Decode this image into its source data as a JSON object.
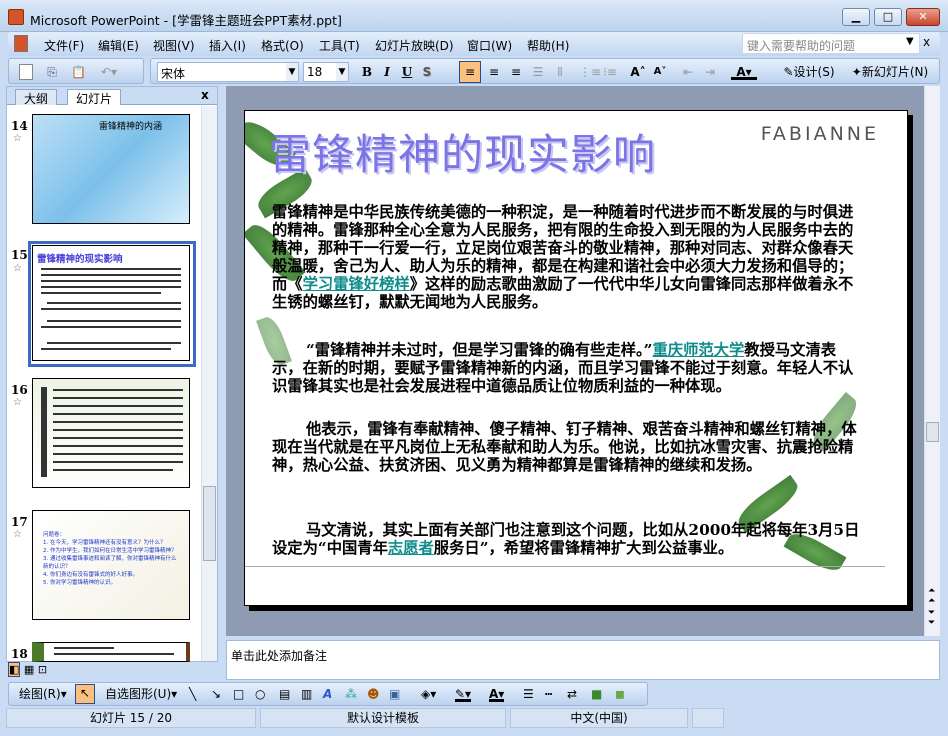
{
  "window": {
    "title": "Microsoft PowerPoint - [学雷锋主题班会PPT素材.ppt]",
    "controls": [
      "minimize",
      "restore",
      "close"
    ]
  },
  "menu": [
    "文件(F)",
    "编辑(E)",
    "视图(V)",
    "插入(I)",
    "格式(O)",
    "工具(T)",
    "幻灯片放映(D)",
    "窗口(W)",
    "帮助(H)"
  ],
  "help_placeholder": "键入需要帮助的问题",
  "toolbar": {
    "font": "宋体",
    "size": "18",
    "bold": "B",
    "italic": "I",
    "underline": "U",
    "shadow": "S",
    "design": "设计(S)",
    "new_slide": "新幻灯片(N)"
  },
  "pane": {
    "tabs": [
      "大纲",
      "幻灯片"
    ],
    "close": "x",
    "thumbs": [
      {
        "num": "14",
        "title": "雷锋精神的内涵"
      },
      {
        "num": "15",
        "title": "雷锋精神的现实影响",
        "selected": true
      },
      {
        "num": "16"
      },
      {
        "num": "17",
        "lines": [
          "问题卷：",
          "1. 在今天，学习雷锋精神还有没有意义？为什么？",
          "2. 作为中学生，我们如何在日常生活中学习雷锋精神？",
          "3. 通过收集雷锋事迹和阅读了解，你对雷锋精神有什么新的认识？",
          "4. 你们身边有没有雷锋式的好人好事。",
          "5. 你对学习雷锋精神的认识。"
        ]
      },
      {
        "num": "18"
      }
    ]
  },
  "slide": {
    "title": "雷锋精神的现实影响",
    "brand": "FABIANNE",
    "p1": [
      "雷锋精神是中华民族传统美德的一种积淀，是一种随着时代进步而不断发展的与时俱进的精神。雷锋那种全心全意为人民服务，把有限的生命投入到无限的为人民服务中去的精神，那种干一行爱一行，立足岗位艰苦奋斗的敬业精神，那种对同志、对群众像春天般温暖，舍己为人、助人为乐的精神，都是在构建和谐社会中必须大力发扬和倡导的；而《",
      "学习雷锋好榜样",
      "》这样的励志歌曲激励了一代代中华儿女向雷锋同志那样做着永不生锈的螺丝钉，默默无闻地为人民服务。"
    ],
    "p2": [
      "“雷锋精神并未过时，但是学习雷锋的确有些走样。”",
      "重庆师范大学",
      "教授马文清表示，在新的时期，要赋予雷锋精神新的内涵，而且学习雷锋不能过于刻意。年轻人不认识雷锋其实也是社会发展进程中道德品质让位物质利益的一种体现。"
    ],
    "p3": "他表示，雷锋有奉献精神、傻子精神、钉子精神、艰苦奋斗精神和螺丝钉精神，体现在当代就是在平凡岗位上无私奉献和助人为乐。他说，比如抗冰雪灾害、抗震抢险精神，热心公益、扶贫济困、见义勇为精神都算是雷锋精神的继续和发扬。",
    "p4": [
      "马文清说，其实上面有关部门也注意到这个问题，比如从2000年起将每年3月5日设定为“中国青年",
      "志愿者",
      "服务日”，希望将雷锋精神扩大到公益事业。"
    ]
  },
  "notes_placeholder": "单击此处添加备注",
  "drawing": {
    "draw": "绘图(R)",
    "autoshapes": "自选图形(U)"
  },
  "status": {
    "slide": "幻灯片 15 / 20",
    "template": "默认设计模板",
    "language": "中文(中国)"
  },
  "colors": {
    "link": "#0e8c8c",
    "title": "#7b74e6",
    "selection": "#3d6bc4"
  }
}
